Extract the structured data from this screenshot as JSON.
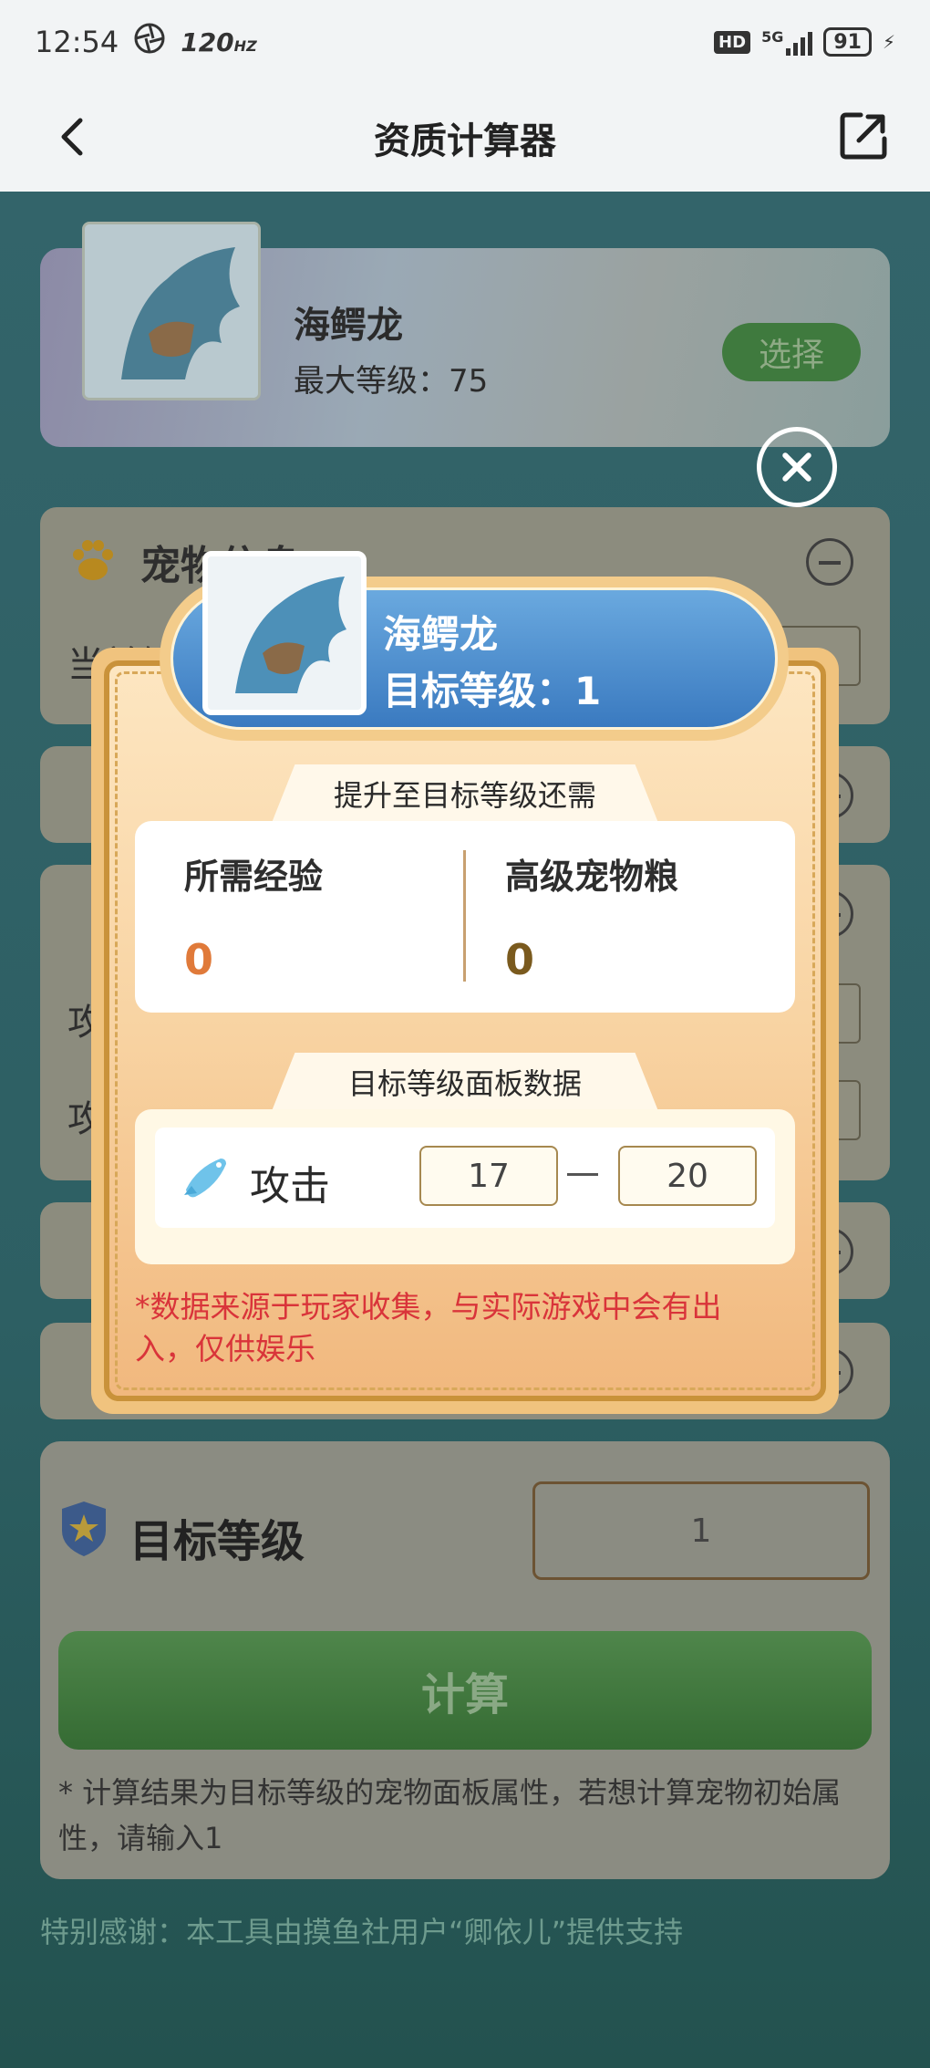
{
  "status_bar": {
    "time": "12:54",
    "refresh_rate": "120",
    "hd": "HD",
    "network": "5G",
    "battery": "91"
  },
  "header": {
    "title": "资质计算器"
  },
  "pet": {
    "name": "海鳄龙",
    "max_level_text": "最大等级：75",
    "select_label": "选择"
  },
  "background_sections": [
    {
      "title_partial": "宠物信息",
      "label_partial": "当前等"
    },
    {
      "label_a": "攻",
      "label_b": "攻"
    }
  ],
  "target": {
    "title": "目标等级",
    "value": "1",
    "calc_label": "计算",
    "note": "* 计算结果为目标等级的宠物面板属性，若想计算宠物初始属性，请输入1"
  },
  "thanks": "特别感谢：本工具由摸鱼社用户“卿依儿”提供支持",
  "modal": {
    "pet_name": "海鳄龙",
    "target_level_text": "目标等级：1",
    "required_tab": "提升至目标等级还需",
    "exp_label": "所需经验",
    "exp_value": "0",
    "food_label": "高级宠物粮",
    "food_value": "0",
    "panel_tab": "目标等级面板数据",
    "attack_label": "攻击",
    "attack_min": "17",
    "attack_max": "20",
    "disclaimer": "*数据来源于玩家收集，与实际游戏中会有出入，仅供娱乐"
  },
  "colors": {
    "exp_value": "#e07a3a",
    "food_value": "#7a5a1e",
    "warning": "#d9343a",
    "pill_blue": "#3a7ac0"
  }
}
